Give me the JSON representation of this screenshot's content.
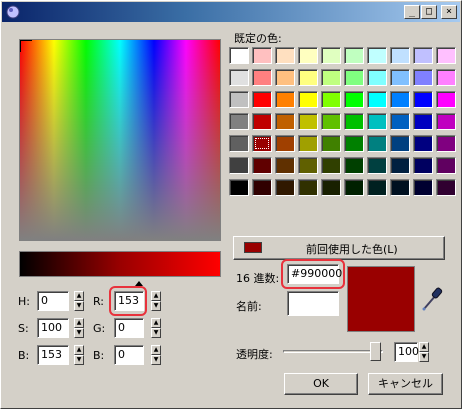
{
  "window": {
    "title": "",
    "buttons": {
      "minimize": "_",
      "maximize": "□",
      "close": "×"
    }
  },
  "basic_colors": {
    "label": "既定の色:",
    "rows": [
      [
        "#ffffff",
        "#ffc0c0",
        "#ffe0c0",
        "#ffffc0",
        "#e0ffc0",
        "#c0ffc0",
        "#c0ffff",
        "#c0e0ff",
        "#c0c0ff",
        "#ffc0ff"
      ],
      [
        "#e0e0e0",
        "#ff8080",
        "#ffc080",
        "#ffff80",
        "#c0ff80",
        "#80ff80",
        "#80ffff",
        "#80c0ff",
        "#8080ff",
        "#ff80ff"
      ],
      [
        "#c0c0c0",
        "#ff0000",
        "#ff8000",
        "#ffff00",
        "#80ff00",
        "#00ff00",
        "#00ffff",
        "#0080ff",
        "#0000ff",
        "#ff00ff"
      ],
      [
        "#808080",
        "#c00000",
        "#c06000",
        "#c0c000",
        "#60c000",
        "#00c000",
        "#00c0c0",
        "#0060c0",
        "#0000c0",
        "#c000c0"
      ],
      [
        "#606060",
        "#990000",
        "#a04000",
        "#a0a000",
        "#408000",
        "#008000",
        "#008080",
        "#004080",
        "#000080",
        "#800080"
      ],
      [
        "#404040",
        "#600000",
        "#603000",
        "#606000",
        "#304000",
        "#004000",
        "#004040",
        "#002040",
        "#000060",
        "#600060"
      ],
      [
        "#000000",
        "#300000",
        "#301800",
        "#303000",
        "#182000",
        "#002000",
        "#002020",
        "#001020",
        "#000030",
        "#300030"
      ]
    ],
    "selected": [
      4,
      1
    ]
  },
  "recent_button": {
    "label": "前回使用した色(L)",
    "swatch": "#990000"
  },
  "hsv": {
    "h_label": "H:",
    "h_value": "0",
    "s_label": "S:",
    "s_value": "100",
    "b_label": "B:",
    "b_value": "153"
  },
  "rgb": {
    "r_label": "R:",
    "r_value": "153",
    "g_label": "G:",
    "g_value": "0",
    "b_label": "B:",
    "b_value": "0"
  },
  "hex": {
    "label": "16 進数:",
    "value": "#990000"
  },
  "name": {
    "label": "名前:",
    "value": ""
  },
  "preview_color": "#990000",
  "opacity": {
    "label": "透明度:",
    "value": "100",
    "level_percent": 100
  },
  "ok_label": "OK",
  "cancel_label": "キャンセル",
  "accent_color": "#e8323c"
}
